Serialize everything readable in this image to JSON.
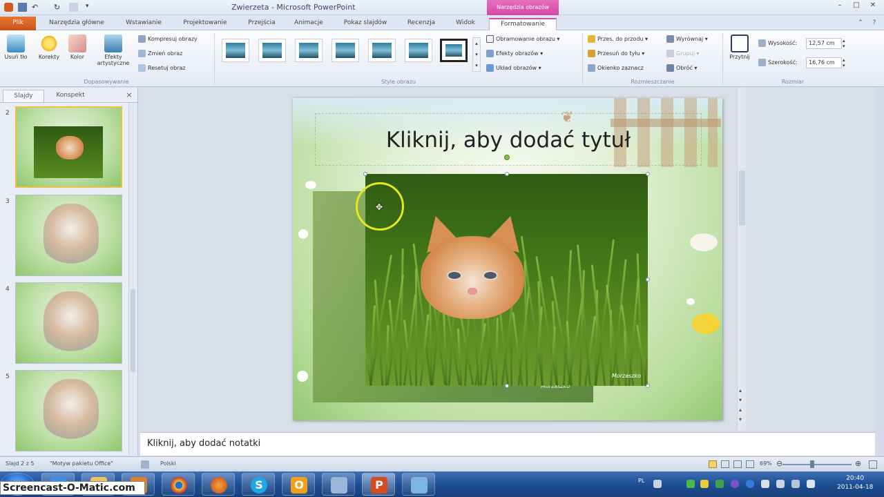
{
  "window": {
    "title": "Zwierzeta - Microsoft PowerPoint",
    "context_tab": "Narzędzia obrazów"
  },
  "tabs": [
    {
      "label": "Plik"
    },
    {
      "label": "Narzędzia główne"
    },
    {
      "label": "Wstawianie"
    },
    {
      "label": "Projektowanie"
    },
    {
      "label": "Przejścia"
    },
    {
      "label": "Animacje"
    },
    {
      "label": "Pokaz slajdów"
    },
    {
      "label": "Recenzja"
    },
    {
      "label": "Widok"
    },
    {
      "label": "Formatowanie"
    }
  ],
  "ribbon": {
    "adjust": {
      "remove_bg": "Usuń tło",
      "corrections": "Korekty",
      "color": "Kolor",
      "artistic": "Efekty artystyczne",
      "compress": "Kompresuj obrazy",
      "change": "Zmień obraz",
      "reset": "Resetuj obraz",
      "group_label": "Dopasowywanie"
    },
    "styles": {
      "group_label": "Style obrazu",
      "border": "Obramowanie obrazu",
      "effects": "Efekty obrazów",
      "layout": "Układ obrazów"
    },
    "arrange": {
      "bring_forward": "Przes. do przodu",
      "send_backward": "Przesuń do tyłu",
      "selection_pane": "Okienko zaznacz",
      "align": "Wyrównaj",
      "group": "Grupuj",
      "rotate": "Obróć",
      "group_label": "Rozmieszczanie"
    },
    "size": {
      "crop": "Przytnij",
      "height_label": "Wysokość:",
      "height_value": "12,57 cm",
      "width_label": "Szerokość:",
      "width_value": "16,76 cm",
      "group_label": "Rozmiar"
    }
  },
  "left_pane": {
    "tab_slides": "Slajdy",
    "tab_outline": "Konspekt",
    "close": "×",
    "slides": [
      {
        "number": "2"
      },
      {
        "number": "3"
      },
      {
        "number": "4"
      },
      {
        "number": "5"
      }
    ]
  },
  "slide": {
    "title_placeholder": "Kliknij, aby dodać tytuł"
  },
  "notes": {
    "placeholder": "Kliknij, aby dodać notatki"
  },
  "status": {
    "slide_info": "Slajd 2 z 5",
    "theme": "\"Motyw pakietu Office\"",
    "language": "Polski",
    "zoom": "69%"
  },
  "taskbar": {
    "recorder_watermark": "Screencast-O-Matic.com",
    "language": "PL",
    "time": "20:40",
    "date": "2011-04-18"
  },
  "colors": {
    "file_tab": "#d45e1f",
    "context_tab": "#d447a6",
    "taskbar": "#1d4f93"
  }
}
